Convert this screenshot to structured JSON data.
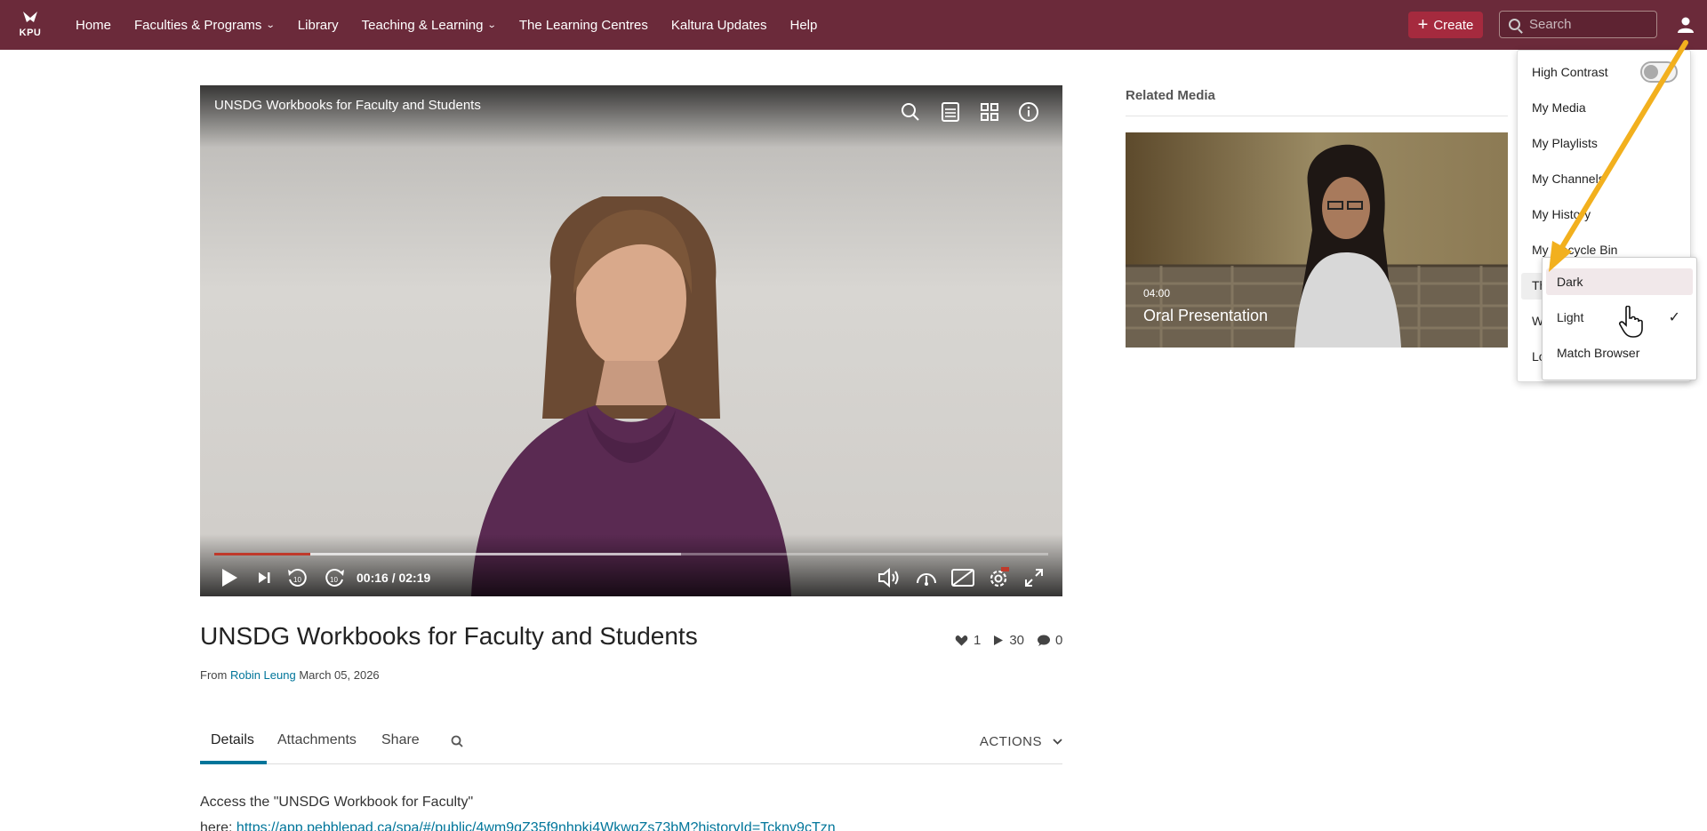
{
  "nav": {
    "logo_text": "KPU",
    "items": [
      {
        "label": "Home",
        "has_dropdown": false
      },
      {
        "label": "Faculties & Programs",
        "has_dropdown": true
      },
      {
        "label": "Library",
        "has_dropdown": false
      },
      {
        "label": "Teaching & Learning",
        "has_dropdown": true
      },
      {
        "label": "The Learning Centres",
        "has_dropdown": false
      },
      {
        "label": "Kaltura Updates",
        "has_dropdown": false
      },
      {
        "label": "Help",
        "has_dropdown": false
      }
    ],
    "create_label": "Create",
    "search_placeholder": "Search"
  },
  "player": {
    "title": "UNSDG Workbooks for Faculty and Students",
    "time_display": "00:16 / 02:19",
    "progress_played": 0.115,
    "progress_buffered": 0.56
  },
  "media": {
    "title": "UNSDG Workbooks for Faculty and Students",
    "from_label": "From",
    "author": "Robin Leung",
    "date": "March 05, 2026",
    "likes": "1",
    "plays": "30",
    "comments": "0"
  },
  "tabs": {
    "details": "Details",
    "attachments": "Attachments",
    "share": "Share",
    "actions": "ACTIONS"
  },
  "description": {
    "line1": "Access the \"UNSDG Workbook for Faculty\"",
    "here_label": "here:",
    "link": "https://app.pebblepad.ca/spa/#/public/4wm9qZ35f9nhpkj4WkwqZs73bM?historyId=Tcknv9cTzn"
  },
  "related": {
    "heading": "Related Media",
    "items": [
      {
        "duration": "04:00",
        "title": "Oral Presentation"
      }
    ]
  },
  "user_menu": {
    "high_contrast": "High Contrast",
    "my_media": "My Media",
    "my_playlists": "My Playlists",
    "my_channels": "My Channels",
    "my_history": "My History",
    "my_recycle_bin": "My Recycle Bin",
    "theme_partial": "Th",
    "w_partial": "W",
    "logout_partial": "Lo"
  },
  "theme_menu": {
    "options": [
      "Dark",
      "Light",
      "Match Browser"
    ],
    "selected": "Light",
    "hovered": "Dark"
  },
  "colors": {
    "nav_bg": "#6b2a3a",
    "create_bg": "#a52a3e",
    "accent": "#00759a",
    "progress": "#c0392b",
    "annotation_arrow": "#f2b01e"
  }
}
